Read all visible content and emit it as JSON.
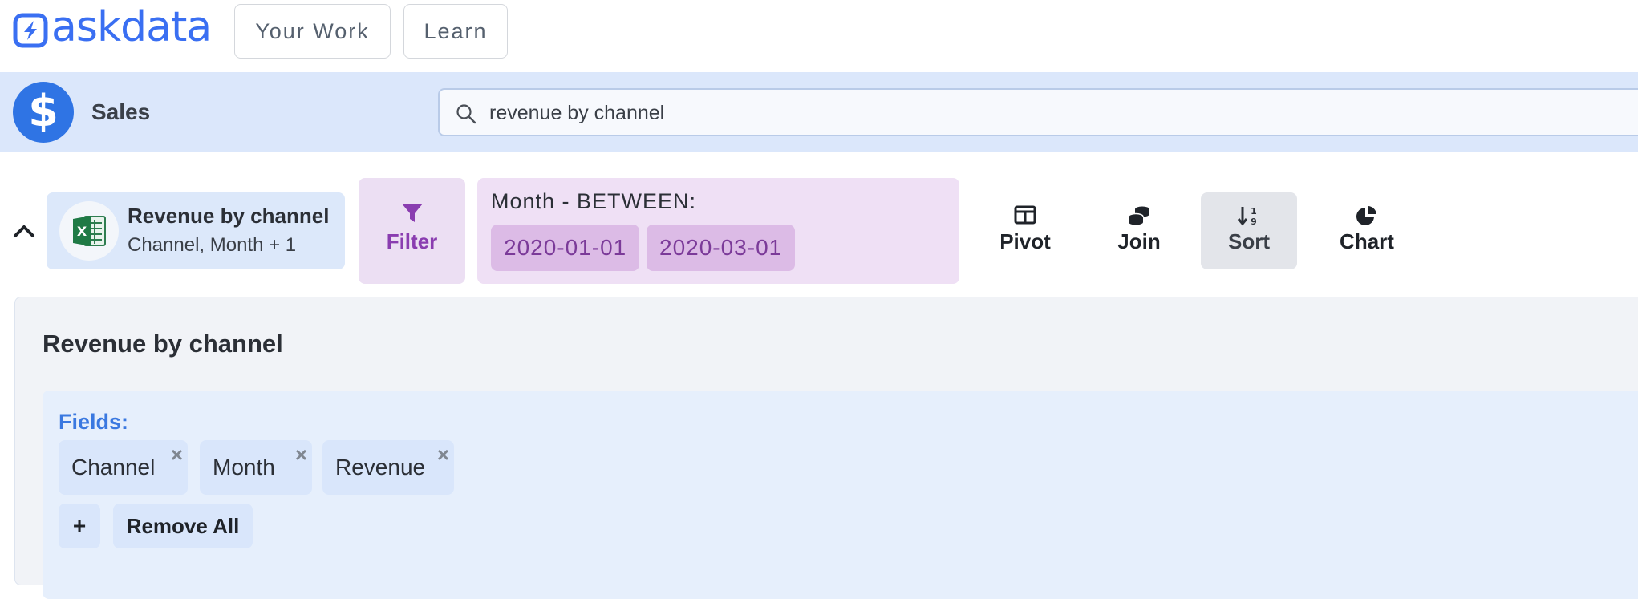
{
  "nav": {
    "logo_text": "askdata",
    "your_work": "Your Work",
    "learn": "Learn"
  },
  "dataset": {
    "icon": "dollar-icon",
    "name": "Sales"
  },
  "search": {
    "value": "revenue by channel"
  },
  "query_card": {
    "title": "Revenue by channel",
    "subtitle": "Channel, Month + 1",
    "icon": "excel-icon"
  },
  "filter": {
    "label": "Filter",
    "condition": "Month - BETWEEN:",
    "from": "2020-01-01",
    "to": "2020-03-01"
  },
  "tools": {
    "pivot": "Pivot",
    "join": "Join",
    "sort": "Sort",
    "chart": "Chart"
  },
  "panel": {
    "title": "Revenue by channel",
    "fields_label": "Fields:",
    "fields": [
      "Channel",
      "Month",
      "Revenue"
    ],
    "remove_symbol": "×",
    "add_label": "+",
    "remove_all_label": "Remove All"
  },
  "colors": {
    "brand": "#3a6ff2",
    "filter_accent": "#8a3db0",
    "fields_label": "#3a78e0"
  }
}
